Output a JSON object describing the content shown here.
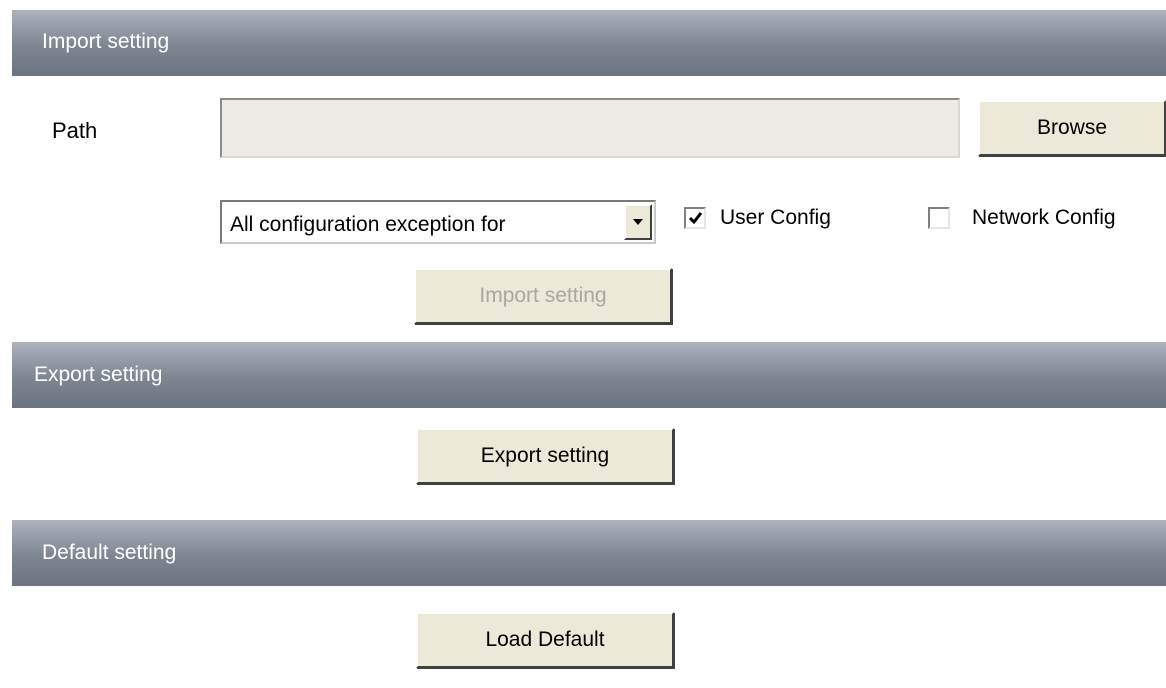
{
  "sections": {
    "import": {
      "title": "Import setting"
    },
    "export": {
      "title": "Export setting"
    },
    "default": {
      "title": "Default setting"
    }
  },
  "import": {
    "path_label": "Path",
    "path_value": "",
    "browse_label": "Browse",
    "mode_select": {
      "selected": "All configuration exception for"
    },
    "user_config": {
      "label": "User Config",
      "checked": true
    },
    "network_config": {
      "label": "Network Config",
      "checked": false
    },
    "import_button_label": "Import setting",
    "import_button_enabled": false
  },
  "export": {
    "button_label": "Export setting"
  },
  "default": {
    "button_label": "Load Default"
  },
  "icons": {
    "select_arrow": "chevron-down-icon",
    "check": "checkmark-icon"
  },
  "colors": {
    "section_bar_top": "#aeb3bd",
    "section_bar_bottom": "#6c7480",
    "button_face": "#ece9d8",
    "disabled_text": "#a9a7a0"
  }
}
